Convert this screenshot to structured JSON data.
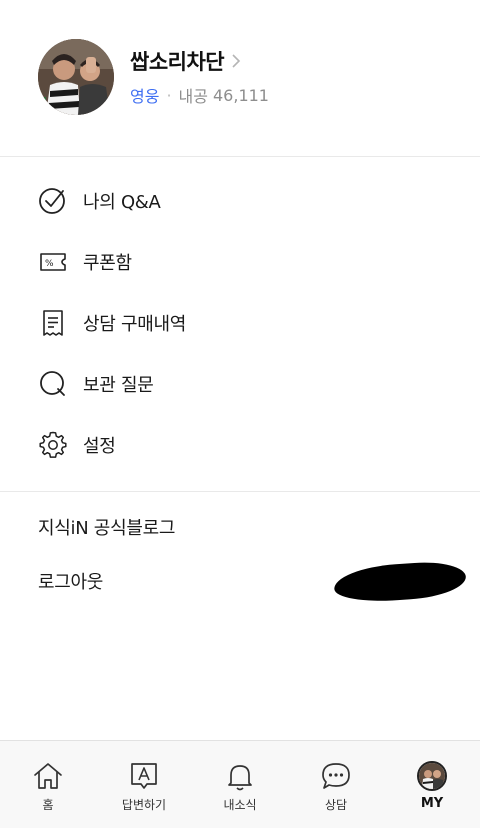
{
  "profile": {
    "name": "쌉소리차단",
    "rank": "영웅",
    "separator": "·",
    "stat_label": "내공",
    "stat_value": "46,111"
  },
  "menu": {
    "items": [
      {
        "label": "나의 Q&A",
        "icon": "check-circle-icon"
      },
      {
        "label": "쿠폰함",
        "icon": "coupon-icon"
      },
      {
        "label": "상담 구매내역",
        "icon": "receipt-icon"
      },
      {
        "label": "보관 질문",
        "icon": "bookmark-question-icon"
      },
      {
        "label": "설정",
        "icon": "gear-icon"
      }
    ]
  },
  "links": {
    "blog": "지식iN 공식블로그",
    "logout": "로그아웃"
  },
  "bottom_nav": {
    "items": [
      {
        "label": "홈",
        "icon": "home-icon"
      },
      {
        "label": "답변하기",
        "icon": "answer-icon"
      },
      {
        "label": "내소식",
        "icon": "bell-icon"
      },
      {
        "label": "상담",
        "icon": "chat-icon"
      },
      {
        "label": "MY",
        "icon": "avatar-icon"
      }
    ]
  },
  "colors": {
    "rank": "#3f6ff2",
    "muted": "#8e8e8e",
    "divider": "#e9e9e9",
    "nav_bg": "#f8f8f8"
  }
}
